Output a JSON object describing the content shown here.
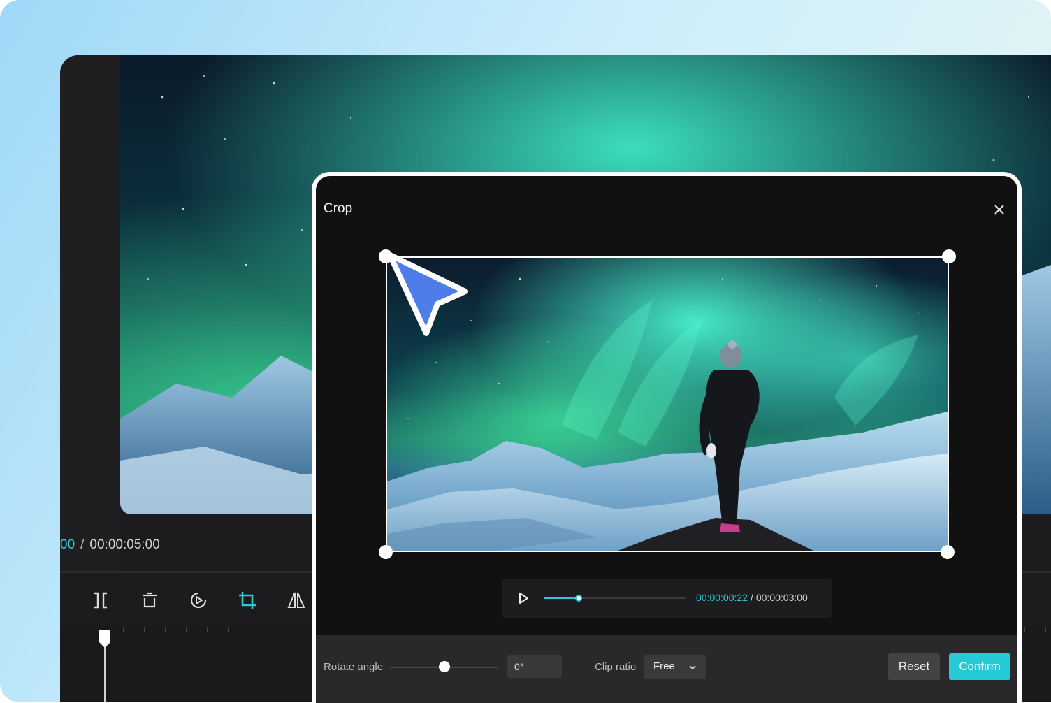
{
  "colors": {
    "accent": "#2fc8d5",
    "confirm_bg": "#26c9d6",
    "cursor": "#4e7dea"
  },
  "editor": {
    "time_current": "00",
    "time_separator": "/",
    "time_total": "00:00:05:00",
    "toolbar": [
      {
        "icon": "split-icon"
      },
      {
        "icon": "delete-icon"
      },
      {
        "icon": "speed-icon"
      },
      {
        "icon": "crop-icon",
        "active": true
      },
      {
        "icon": "mirror-icon"
      }
    ]
  },
  "crop": {
    "title": "Crop",
    "close_icon": "close-icon",
    "player": {
      "progress": 0.24,
      "time_current": "00:00:00:22",
      "time_separator": "/",
      "time_total": "00:00:03:00"
    },
    "rotate_label": "Rotate angle",
    "rotate_value": "0°",
    "rotate_slider": 0.5,
    "clip_ratio_label": "Clip ratio",
    "clip_ratio_value": "Free",
    "reset_label": "Reset",
    "confirm_label": "Confirm"
  }
}
